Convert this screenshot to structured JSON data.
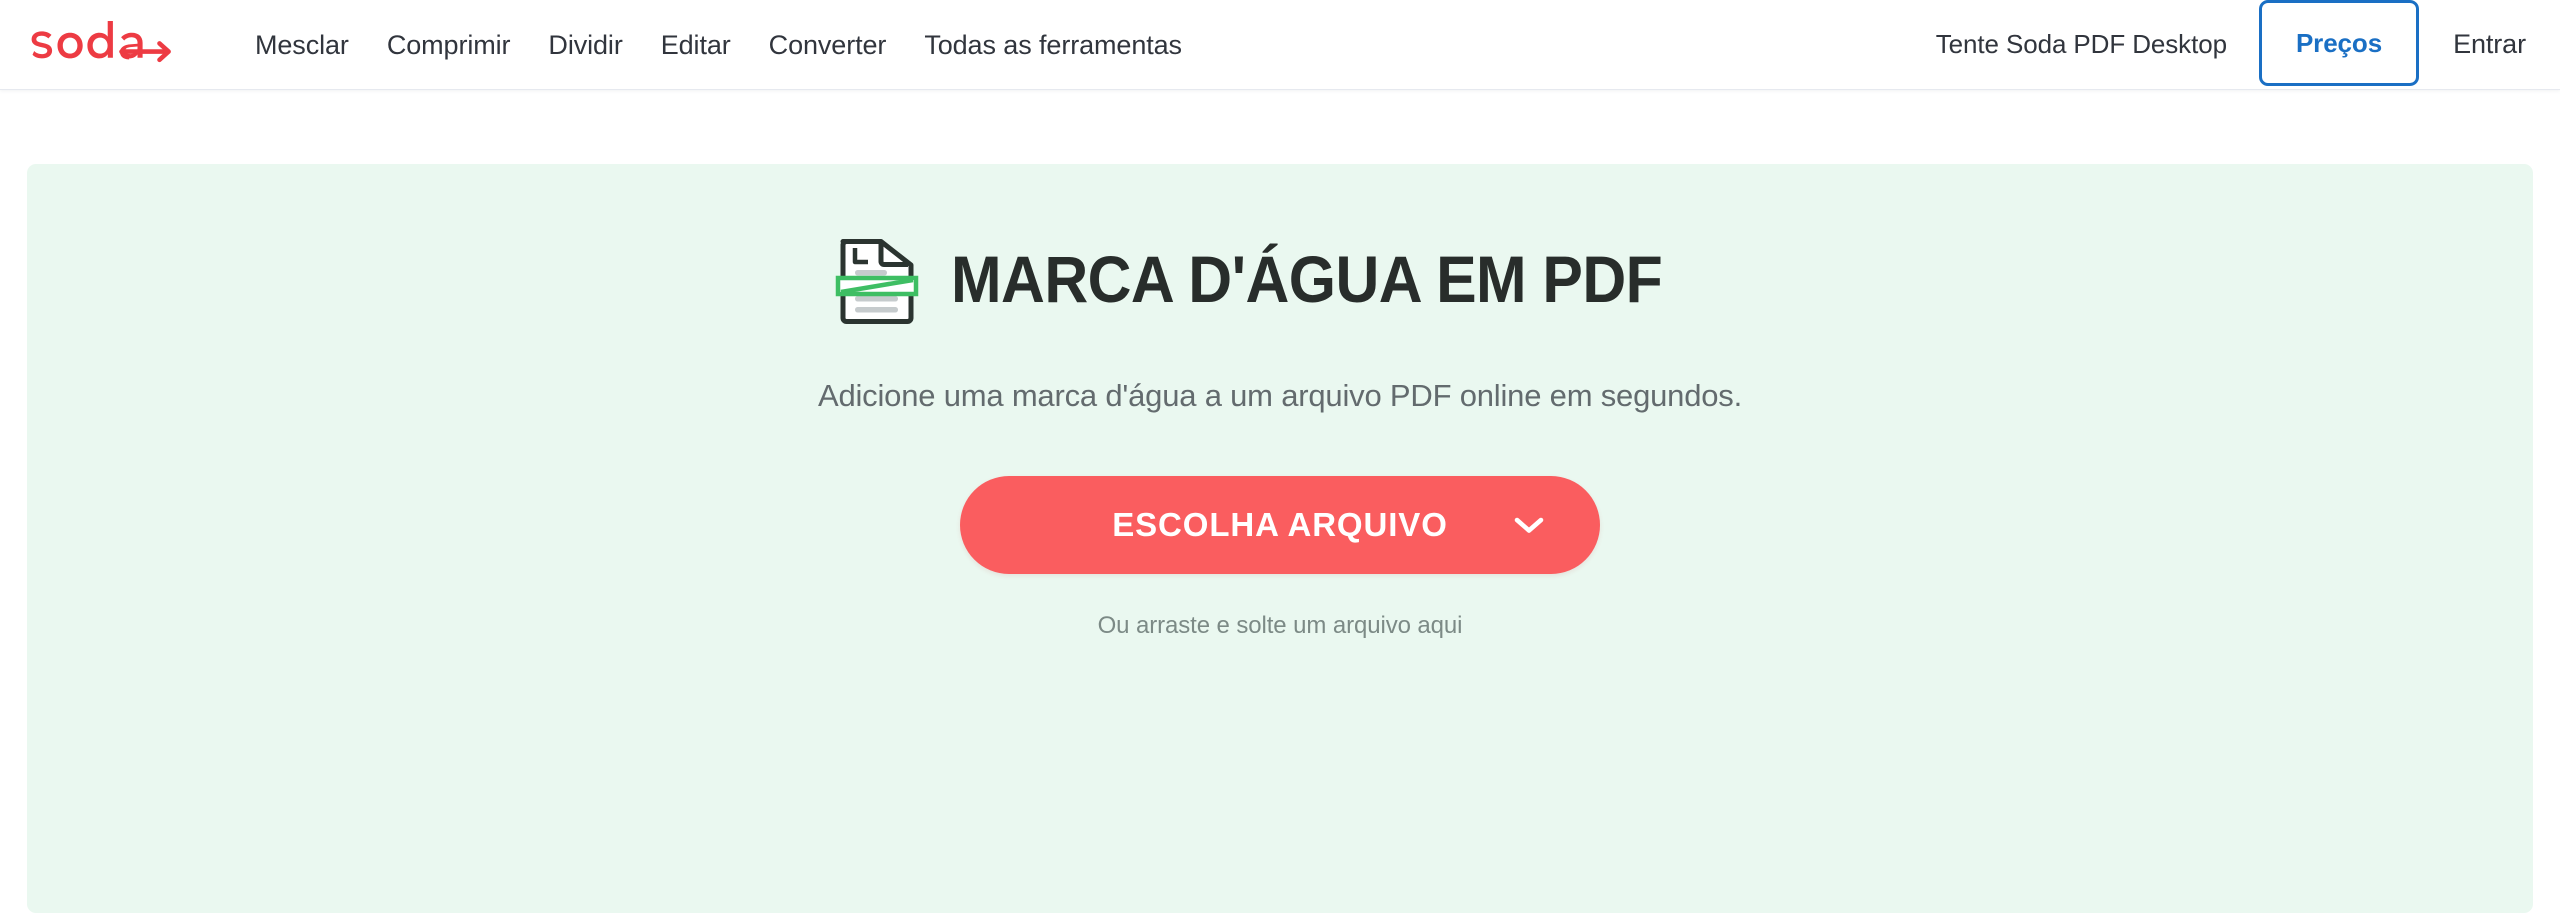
{
  "brand": {
    "logo_text": "soda",
    "logo_arrow": "arrow-right",
    "logo_color": "#ED3B43"
  },
  "header": {
    "nav_items": [
      {
        "label": "Mesclar",
        "name": "nav-item-mesclar"
      },
      {
        "label": "Comprimir",
        "name": "nav-item-comprimir"
      },
      {
        "label": "Dividir",
        "name": "nav-item-dividir"
      },
      {
        "label": "Editar",
        "name": "nav-item-editar"
      },
      {
        "label": "Converter",
        "name": "nav-item-converter"
      },
      {
        "label": "Todas as ferramentas",
        "name": "nav-item-todas-as-ferramentas"
      }
    ],
    "desktop_link": "Tente Soda PDF Desktop",
    "pricing_button": "Preços",
    "signin_link": "Entrar",
    "pricing_color": "#1A6FC4"
  },
  "hero": {
    "title": "MARCA D'ÁGUA EM PDF",
    "subtitle": "Adicione uma marca d'água a um arquivo PDF online em segundos.",
    "choose_button": "ESCOLHA ARQUIVO",
    "choose_button_chevron": "chevron-down-icon",
    "drag_text": "Ou arraste e solte um arquivo aqui",
    "icon_name": "pdf-watermark-icon",
    "background_color": "#EAF8F0",
    "accent_color": "#FA5D5F",
    "watermark_green": "#3EBE63"
  }
}
